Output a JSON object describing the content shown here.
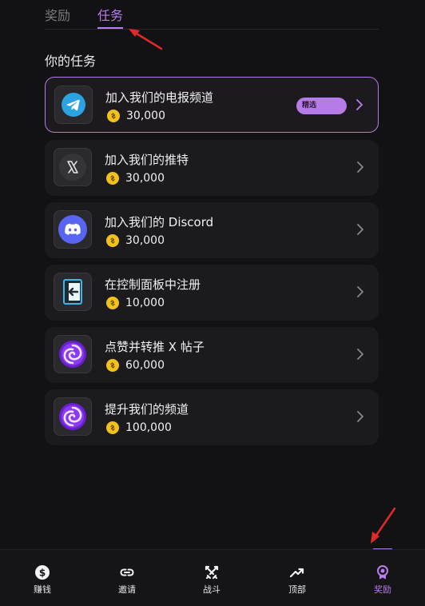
{
  "tabs": [
    {
      "label": "奖励",
      "active": false
    },
    {
      "label": "任务",
      "active": true
    }
  ],
  "section_title": "你的任务",
  "tasks": [
    {
      "title": "加入我们的电报频道",
      "reward": "30,000",
      "badge": "精选",
      "icon": "telegram-icon"
    },
    {
      "title": "加入我们的推特",
      "reward": "30,000",
      "icon": "x-icon"
    },
    {
      "title": "加入我们的 Discord",
      "reward": "30,000",
      "icon": "discord-icon"
    },
    {
      "title": "在控制面板中注册",
      "reward": "10,000",
      "icon": "login-icon"
    },
    {
      "title": "点赞并转推 X 帖子",
      "reward": "60,000",
      "icon": "swirl-icon"
    },
    {
      "title": "提升我们的频道",
      "reward": "100,000",
      "icon": "swirl-icon"
    }
  ],
  "bottom_nav": [
    {
      "label": "赚钱",
      "icon": "dollar-icon",
      "active": false
    },
    {
      "label": "邀请",
      "icon": "link-icon",
      "active": false
    },
    {
      "label": "战斗",
      "icon": "swords-icon",
      "active": false
    },
    {
      "label": "顶部",
      "icon": "trending-up-icon",
      "active": false
    },
    {
      "label": "奖励",
      "icon": "medal-icon",
      "active": true
    }
  ],
  "colors": {
    "accent": "#b87dee",
    "background": "#121113",
    "card": "#1b1a1d",
    "coin": "#f2c21b"
  }
}
